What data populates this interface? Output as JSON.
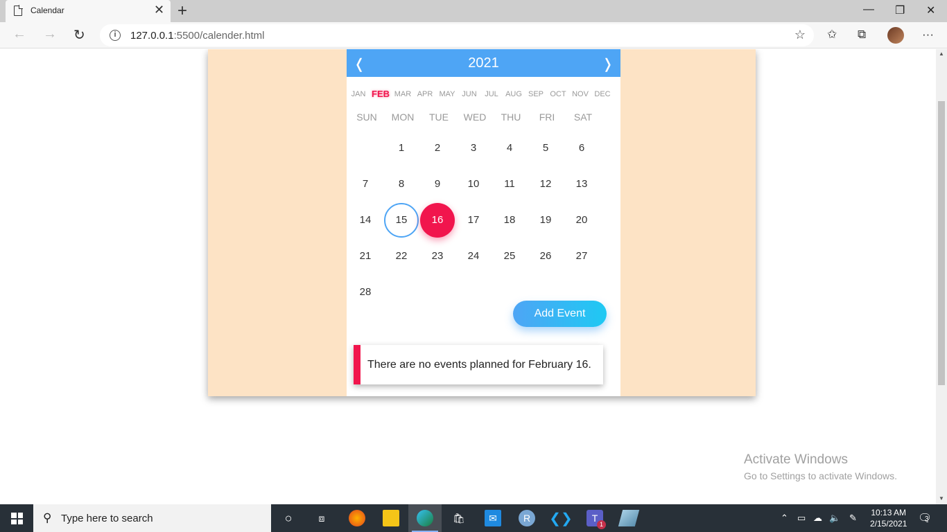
{
  "browser": {
    "tab_title": "Calendar",
    "url_host": "127.0.0.1",
    "url_rest": ":5500/calender.html"
  },
  "calendar": {
    "year": "2021",
    "prev_label": "❬",
    "next_label": "❭",
    "months": [
      "JAN",
      "FEB",
      "MAR",
      "APR",
      "MAY",
      "JUN",
      "JUL",
      "AUG",
      "SEP",
      "OCT",
      "NOV",
      "DEC"
    ],
    "active_month": "FEB",
    "weekdays": [
      "SUN",
      "MON",
      "TUE",
      "WED",
      "THU",
      "FRI",
      "SAT"
    ],
    "first_weekday_index": 1,
    "days_in_month": 28,
    "today": 15,
    "selected": 16,
    "accent_color": "#f1154d",
    "header_color": "#4ea5f5",
    "add_event_label": "Add Event",
    "event_message": "There are no events planned for February 16."
  },
  "watermark": {
    "line1": "Activate Windows",
    "line2": "Go to Settings to activate Windows."
  },
  "taskbar": {
    "search_placeholder": "Type here to search",
    "time": "10:13 AM",
    "date": "2/15/2021",
    "teams_badge": "1",
    "notification_count": "3"
  }
}
